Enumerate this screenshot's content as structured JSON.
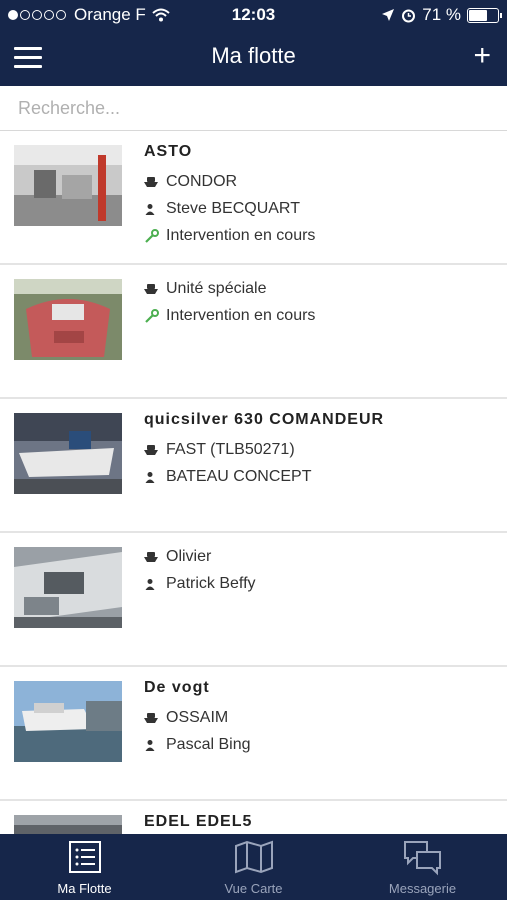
{
  "status_bar": {
    "carrier": "Orange F",
    "time": "12:03",
    "battery": "71 %",
    "battery_level": 0.71
  },
  "navbar": {
    "title": "Ma flotte",
    "add_label": "+"
  },
  "search": {
    "placeholder": "Recherche...",
    "value": ""
  },
  "items": [
    {
      "name": "ASTO",
      "lines": [
        {
          "icon": "boat-icon",
          "text": "CONDOR"
        },
        {
          "icon": "person-icon",
          "text": "Steve BECQUART"
        },
        {
          "icon": "wrench-icon",
          "text": "Intervention en cours",
          "color": "#4caf50"
        }
      ]
    },
    {
      "name": "",
      "lines": [
        {
          "icon": "boat-icon",
          "text": "Unité spéciale"
        },
        {
          "icon": "wrench-icon",
          "text": "Intervention en cours",
          "color": "#4caf50"
        }
      ]
    },
    {
      "name": "quicsilver 630 COMANDEUR",
      "lines": [
        {
          "icon": "boat-icon",
          "text": "FAST (TLB50271)"
        },
        {
          "icon": "person-icon",
          "text": "BATEAU CONCEPT"
        }
      ]
    },
    {
      "name": "",
      "lines": [
        {
          "icon": "boat-icon",
          "text": "Olivier"
        },
        {
          "icon": "person-icon",
          "text": "Patrick Beffy"
        }
      ]
    },
    {
      "name": "De vogt",
      "lines": [
        {
          "icon": "boat-icon",
          "text": "OSSAIM"
        },
        {
          "icon": "person-icon",
          "text": "Pascal Bing"
        }
      ]
    },
    {
      "name": "EDEL EDEL5",
      "lines": []
    }
  ],
  "tabs": [
    {
      "label": "Ma Flotte",
      "active": true
    },
    {
      "label": "Vue Carte",
      "active": false
    },
    {
      "label": "Messagerie",
      "active": false
    }
  ],
  "colors": {
    "navy": "#16264a",
    "accent_green": "#4caf50"
  }
}
